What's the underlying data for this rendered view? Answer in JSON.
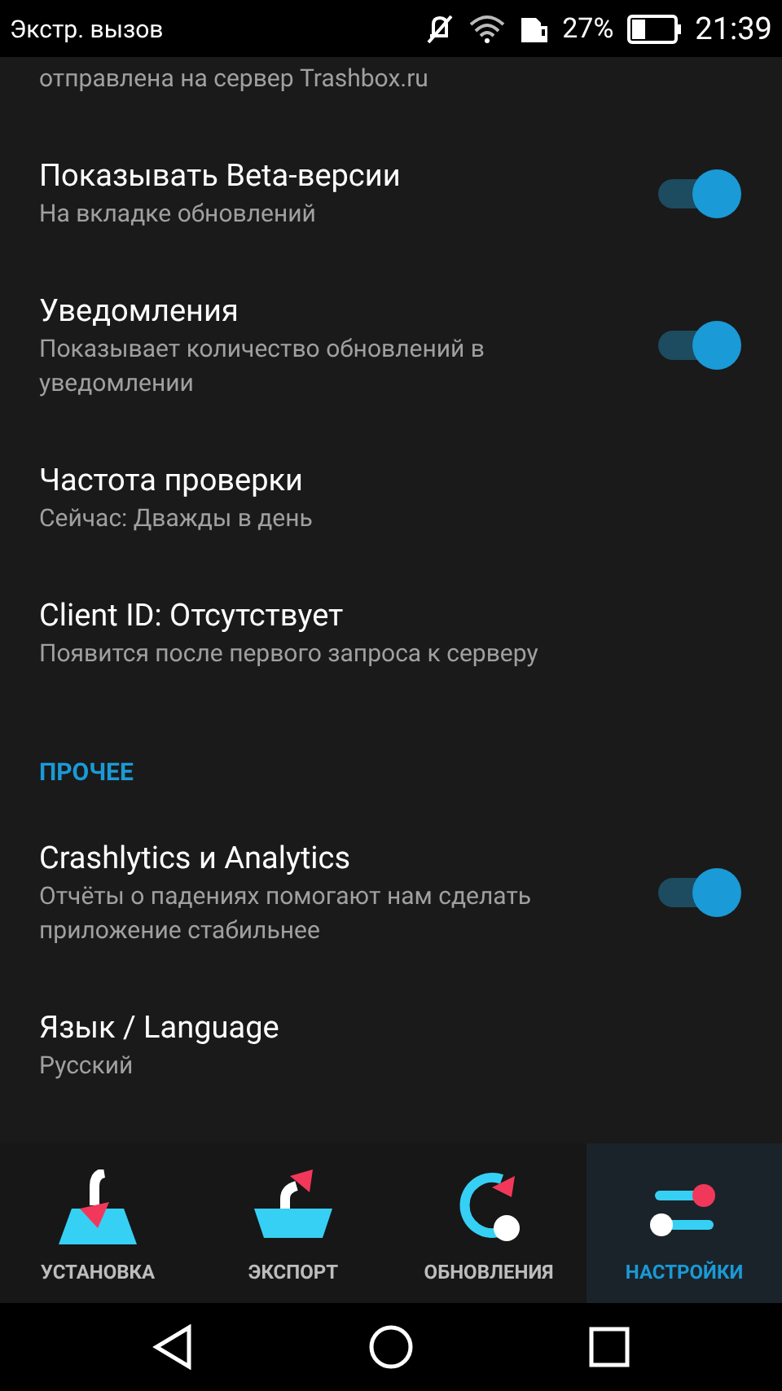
{
  "status_bar": {
    "carrier": "Экстр. вызов",
    "battery": "27%",
    "time": "21:39"
  },
  "items": [
    {
      "kind": "tail",
      "subtitle": "отправлена на сервер Trashbox.ru"
    },
    {
      "kind": "toggle",
      "title": "Показывать Beta-версии",
      "subtitle": "На вкладке обновлений",
      "on": true
    },
    {
      "kind": "toggle",
      "title": "Уведомления",
      "subtitle": "Показывает количество обновлений в уведомлении",
      "on": true
    },
    {
      "kind": "text",
      "title": "Частота проверки",
      "subtitle": "Сейчас: Дважды в день"
    },
    {
      "kind": "text",
      "title": "Client ID: Отсутствует",
      "subtitle": "Появится после первого запроса к серверу"
    },
    {
      "kind": "header",
      "title": "ПРОЧЕЕ"
    },
    {
      "kind": "toggle",
      "title": "Crashlytics и Analytics",
      "subtitle": "Отчёты о падениях помогают нам сделать приложение стабильнее",
      "on": true
    },
    {
      "kind": "text",
      "title": "Язык / Language",
      "subtitle": "Русский"
    }
  ],
  "bottom_nav": [
    {
      "kind": "install",
      "label": "УСТАНОВКА",
      "selected": false
    },
    {
      "kind": "export",
      "label": "ЭКСПОРТ",
      "selected": false
    },
    {
      "kind": "updates",
      "label": "ОБНОВЛЕНИЯ",
      "selected": false
    },
    {
      "kind": "settings",
      "label": "НАСТРОЙКИ",
      "selected": true
    }
  ]
}
